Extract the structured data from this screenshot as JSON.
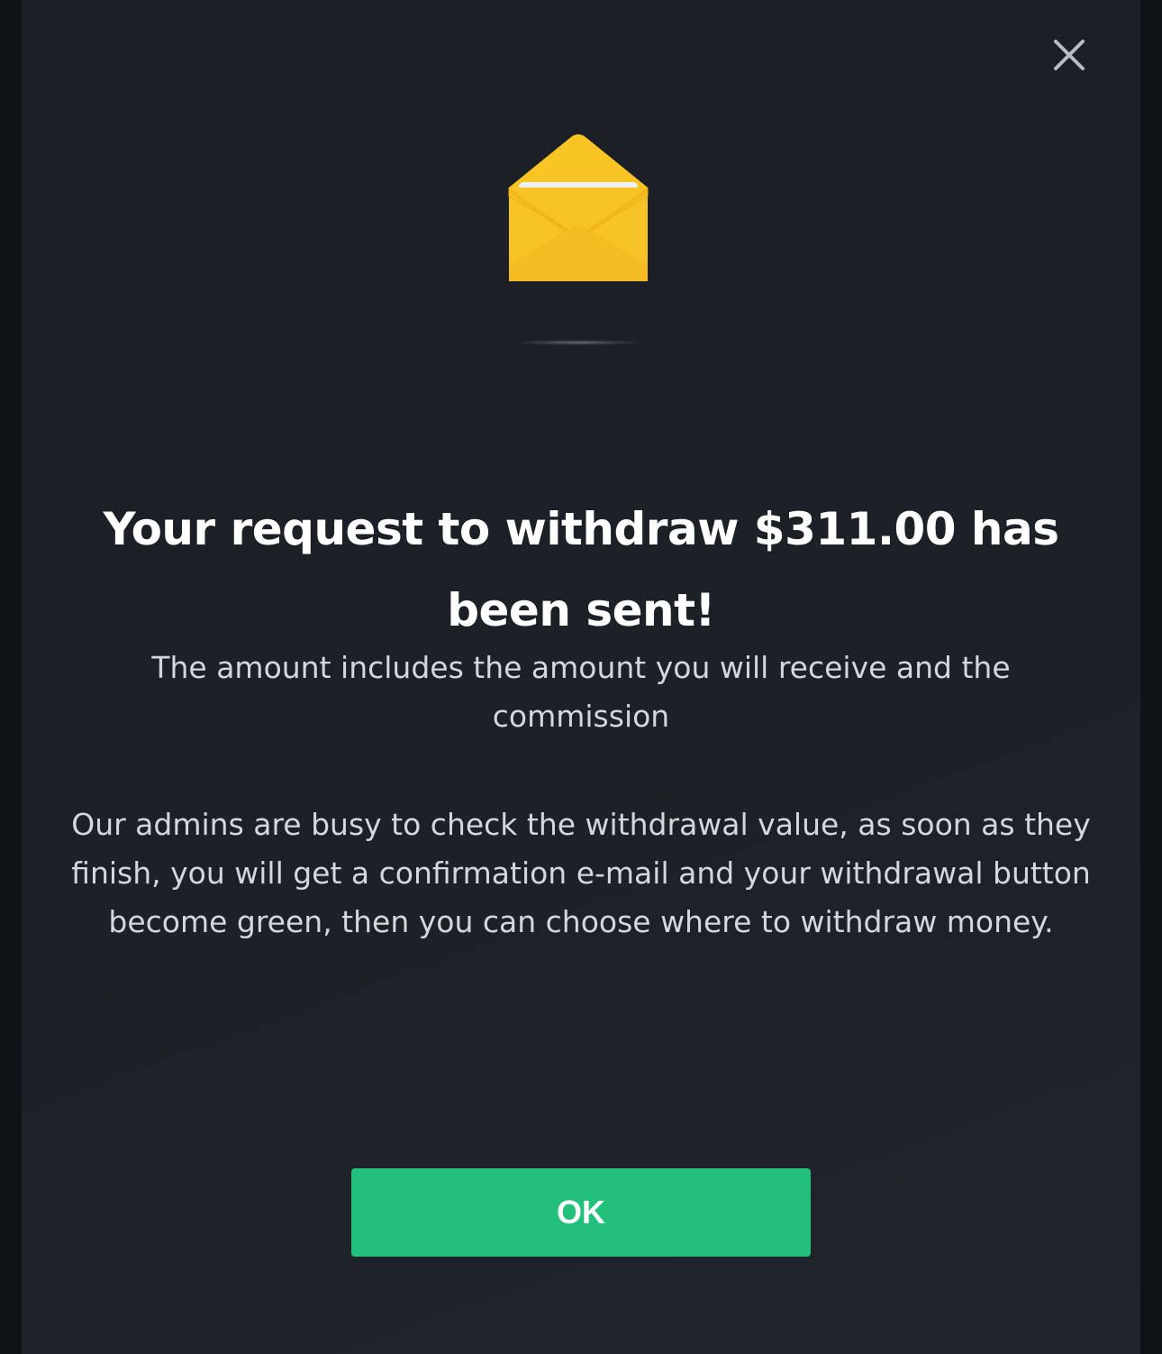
{
  "dialog": {
    "title": "Your request to withdraw $311.00 has been sent!",
    "subtitle": "The amount includes the amount you will receive and the commission",
    "body": "Our admins are busy to check the withdrawal value, as soon as they finish, you will get a confirmation e-mail and your withdrawal button become green, then you can choose where to withdraw money.",
    "ok_label": "OK",
    "close_icon": "close-icon",
    "illustration_icon": "open-envelope-icon"
  },
  "colors": {
    "background": "#1c2027",
    "outer_background": "#0f1318",
    "accent": "#22c07a",
    "envelope": "#f7c325",
    "title_text": "#ffffff",
    "body_text": "#d4d7db"
  }
}
